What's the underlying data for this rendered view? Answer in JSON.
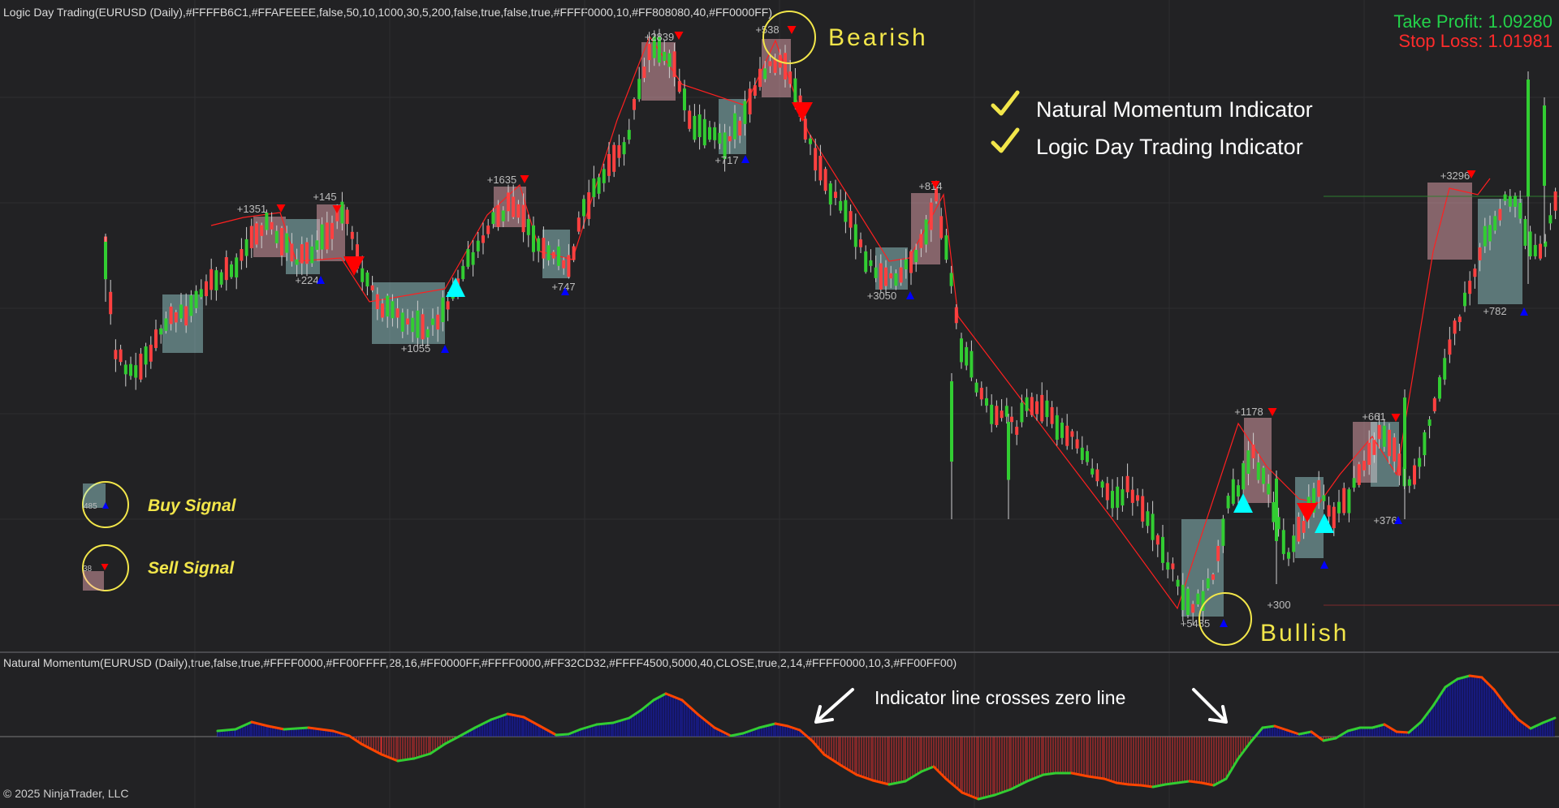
{
  "price_panel": {
    "indicator_header": "Logic Day Trading(EURUSD (Daily),#FFFFB6C1,#FFAFEEEE,false,50,10,1000,30,5,200,false,true,false,true,#FFFF0000,10,#FF808080,40,#FF0000FF)",
    "take_profit": "Take Profit: 1.09280",
    "stop_loss": "Stop Loss: 1.01981",
    "annotation_bearish": "Bearish",
    "annotation_bullish": "Bullish",
    "checklist": [
      "Natural Momentum Indicator",
      "Logic Day Trading Indicator"
    ],
    "legend": {
      "buy_label": "Buy Signal",
      "sell_label": "Sell Signal",
      "buy_sample_text": "485",
      "sell_sample_text": "38"
    },
    "trade_labels": [
      "+1351",
      "+145",
      "+224",
      "+1055",
      "+1635",
      "+747",
      "+2839",
      "+717",
      "+538",
      "+814",
      "+3050",
      "+1178",
      "+300",
      "+5485",
      "+661",
      "+376",
      "+3296",
      "+782"
    ]
  },
  "momentum_panel": {
    "indicator_header": "Natural Momentum(EURUSD (Daily),true,false,true,#FFFF0000,#FF00FFFF,28,16,#FF0000FF,#FFFF0000,#FF32CD32,#FFFF4500,5000,40,CLOSE,true,2,14,#FFFF0000,10,3,#FF00FF00)",
    "annotation": "Indicator line crosses zero line"
  },
  "copyright": "© 2025 NinjaTrader, LLC",
  "colors": {
    "background": "#222224",
    "bull_candle": "#32cd32",
    "bear_candle": "#ff4040",
    "buy_box": "#afeeee",
    "sell_box": "#ffb6c1",
    "signal_up": "#00ffff",
    "signal_down": "#ff0000",
    "momentum_up": "#32cd32",
    "momentum_down": "#ff4500",
    "histogram_positive": "#0000ff",
    "histogram_negative": "#ff0000",
    "annotation_yellow": "#f2e64a"
  }
}
